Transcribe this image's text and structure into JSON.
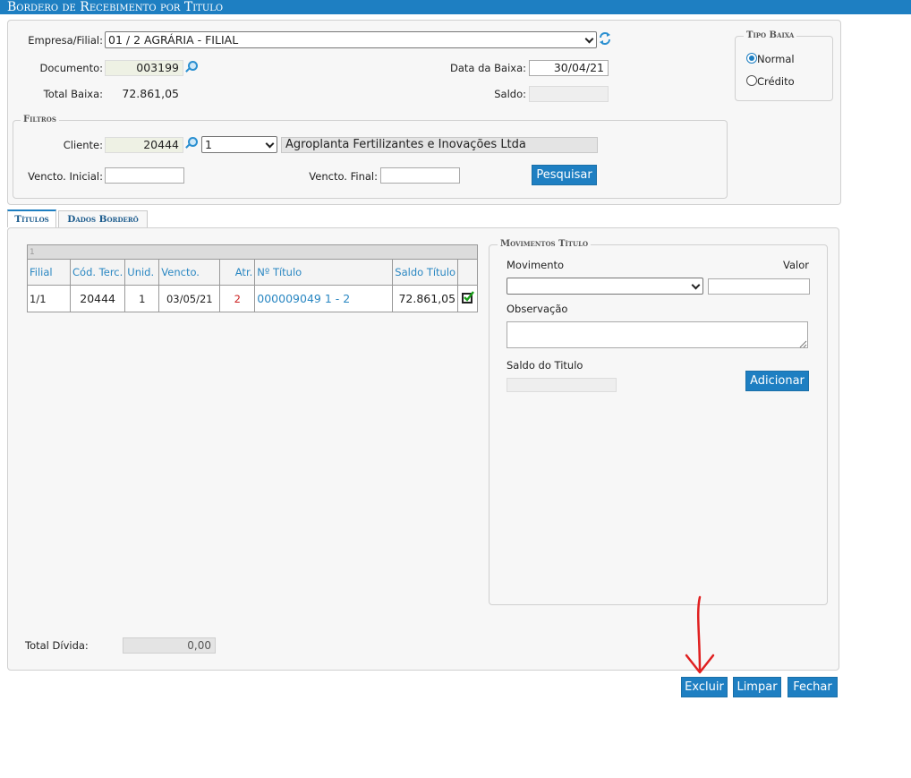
{
  "window": {
    "title": "Bordero de Recebimento por Titulo"
  },
  "header": {
    "empresa_label": "Empresa/Filial:",
    "empresa_value": "01 / 2 AGRÁRIA - FILIAL",
    "documento_label": "Documento:",
    "documento_value": "003199",
    "data_baixa_label": "Data da Baixa:",
    "data_baixa_value": "30/04/21",
    "total_baixa_label": "Total Baixa:",
    "total_baixa_value": "72.861,05",
    "saldo_label": "Saldo:",
    "saldo_value": ""
  },
  "tipo_baixa": {
    "legend": "Tipo Baixa",
    "options": [
      {
        "label": "Normal",
        "selected": true
      },
      {
        "label": "Crédito",
        "selected": false
      }
    ]
  },
  "filtros": {
    "legend": "Filtros",
    "cliente_label": "Cliente:",
    "cliente_code": "20444",
    "cliente_select": "1",
    "cliente_name": "Agroplanta Fertilizantes e Inovações Ltda",
    "vencto_inicial_label": "Vencto. Inicial:",
    "vencto_inicial_value": "",
    "vencto_final_label": "Vencto. Final:",
    "vencto_final_value": "",
    "pesquisar_label": "Pesquisar"
  },
  "tabs": [
    {
      "label": "Títulos",
      "active": true
    },
    {
      "label": "Dados Borderô",
      "active": false
    }
  ],
  "grid": {
    "page_indicator": "1",
    "columns": [
      "Filial",
      "Cód. Terc.",
      "Unid.",
      "Vencto.",
      "Atr.",
      "Nº Título",
      "Saldo Título"
    ],
    "rows": [
      {
        "filial": "1/1",
        "cod_terc": "20444",
        "unid": "1",
        "vencto": "03/05/21",
        "atr": "2",
        "num_titulo": "000009049 1 - 2",
        "saldo": "72.861,05"
      }
    ]
  },
  "movimentos": {
    "legend": "Movimentos Título",
    "movimento_label": "Movimento",
    "movimento_value": "",
    "valor_label": "Valor",
    "valor_value": "",
    "observacao_label": "Observação",
    "observacao_value": "",
    "saldo_titulo_label": "Saldo do Titulo",
    "saldo_titulo_value": "",
    "adicionar_label": "Adicionar"
  },
  "footer": {
    "total_divida_label": "Total Dívida:",
    "total_divida_value": "0,00"
  },
  "actions": {
    "excluir_label": "Excluir",
    "limpar_label": "Limpar",
    "fechar_label": "Fechar"
  },
  "colors": {
    "accent": "#1e7fc2",
    "link": "#2a87c2",
    "annotation_arrow": "#e02020",
    "atraso_text": "#cc2222"
  }
}
